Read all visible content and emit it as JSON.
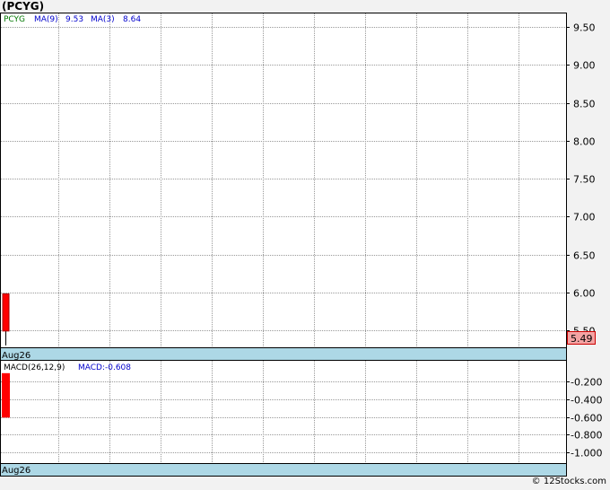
{
  "title": "(PCYG)",
  "footer": "© 12Stocks.com",
  "colors": {
    "ticker": "#007700",
    "ma": "#0000cc",
    "candle": "#ff0000",
    "date_band": "#add8e6",
    "last_price_box": "#f4a3a3",
    "grid": "#999999"
  },
  "chart_data": [
    {
      "type": "candlestick",
      "ticker_label": "PCYG",
      "legend": [
        {
          "name": "MA(9)",
          "value": "9.53"
        },
        {
          "name": "MA(3)",
          "value": "8.64"
        }
      ],
      "y_ticks": [
        "9.50",
        "9.00",
        "8.50",
        "8.00",
        "7.50",
        "7.00",
        "6.50",
        "6.00",
        "5.50"
      ],
      "ylim": [
        5.4,
        9.6
      ],
      "grid": true,
      "last_price": "5.49",
      "x_label": "Aug26",
      "candles": [
        {
          "x": "Aug26",
          "open": 5.98,
          "close": 5.49,
          "high": 5.98,
          "low": 5.49
        }
      ]
    },
    {
      "type": "bar",
      "legend": [
        {
          "name": "MACD(26,12,9)",
          "value": ""
        },
        {
          "name": "MACD:",
          "value": "-0.608"
        }
      ],
      "y_ticks": [
        "-0.200",
        "-0.400",
        "-0.600",
        "-0.800",
        "-1.000"
      ],
      "ylim": [
        -1.15,
        -0.05
      ],
      "grid": true,
      "x_label": "Aug26",
      "bars": [
        {
          "x": "Aug26",
          "top": -0.107,
          "bottom": -0.608
        }
      ]
    }
  ]
}
